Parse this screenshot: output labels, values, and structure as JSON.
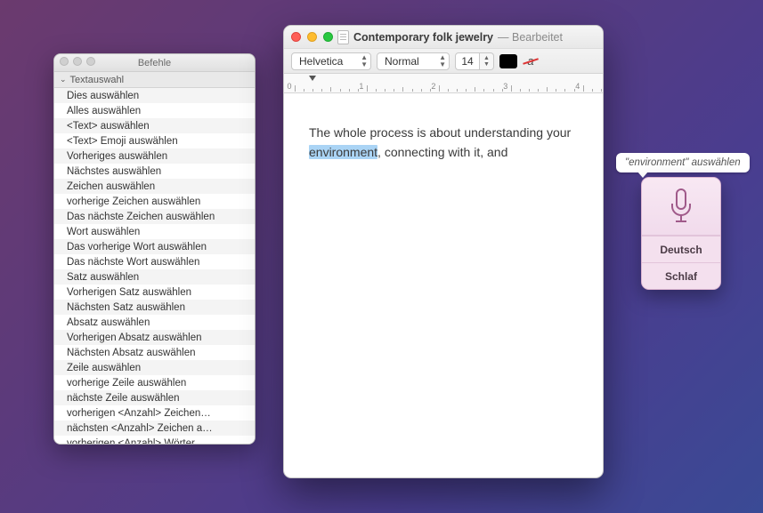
{
  "commands_panel": {
    "title": "Befehle",
    "section": "Textauswahl",
    "items": [
      "Dies auswählen",
      "Alles auswählen",
      "<Text> auswählen",
      "<Text> Emoji auswählen",
      "Vorheriges auswählen",
      "Nächstes auswählen",
      "Zeichen auswählen",
      "vorherige Zeichen auswählen",
      "Das nächste Zeichen auswählen",
      "Wort auswählen",
      "Das vorherige Wort auswählen",
      "Das nächste Wort auswählen",
      "Satz auswählen",
      "Vorherigen Satz auswählen",
      "Nächsten Satz auswählen",
      "Absatz auswählen",
      "Vorherigen Absatz auswählen",
      "Nächsten Absatz auswählen",
      "Zeile auswählen",
      "vorherige Zeile auswählen",
      "nächste Zeile auswählen",
      "vorherigen <Anzahl> Zeichen…",
      "nächsten <Anzahl> Zeichen a…",
      "vorherigen <Anzahl> Wörter …"
    ]
  },
  "textedit": {
    "title": "Contemporary folk jewelry",
    "status": "Bearbeitet",
    "font": "Helvetica",
    "style": "Normal",
    "size": "14",
    "ruler_max": 4,
    "body_pre": "The whole process is about understanding your ",
    "body_hl": "environment",
    "body_post": ", connecting with it, and"
  },
  "voice": {
    "bubble": "\"environment\" auswählen",
    "language": "Deutsch",
    "sleep": "Schlaf"
  }
}
